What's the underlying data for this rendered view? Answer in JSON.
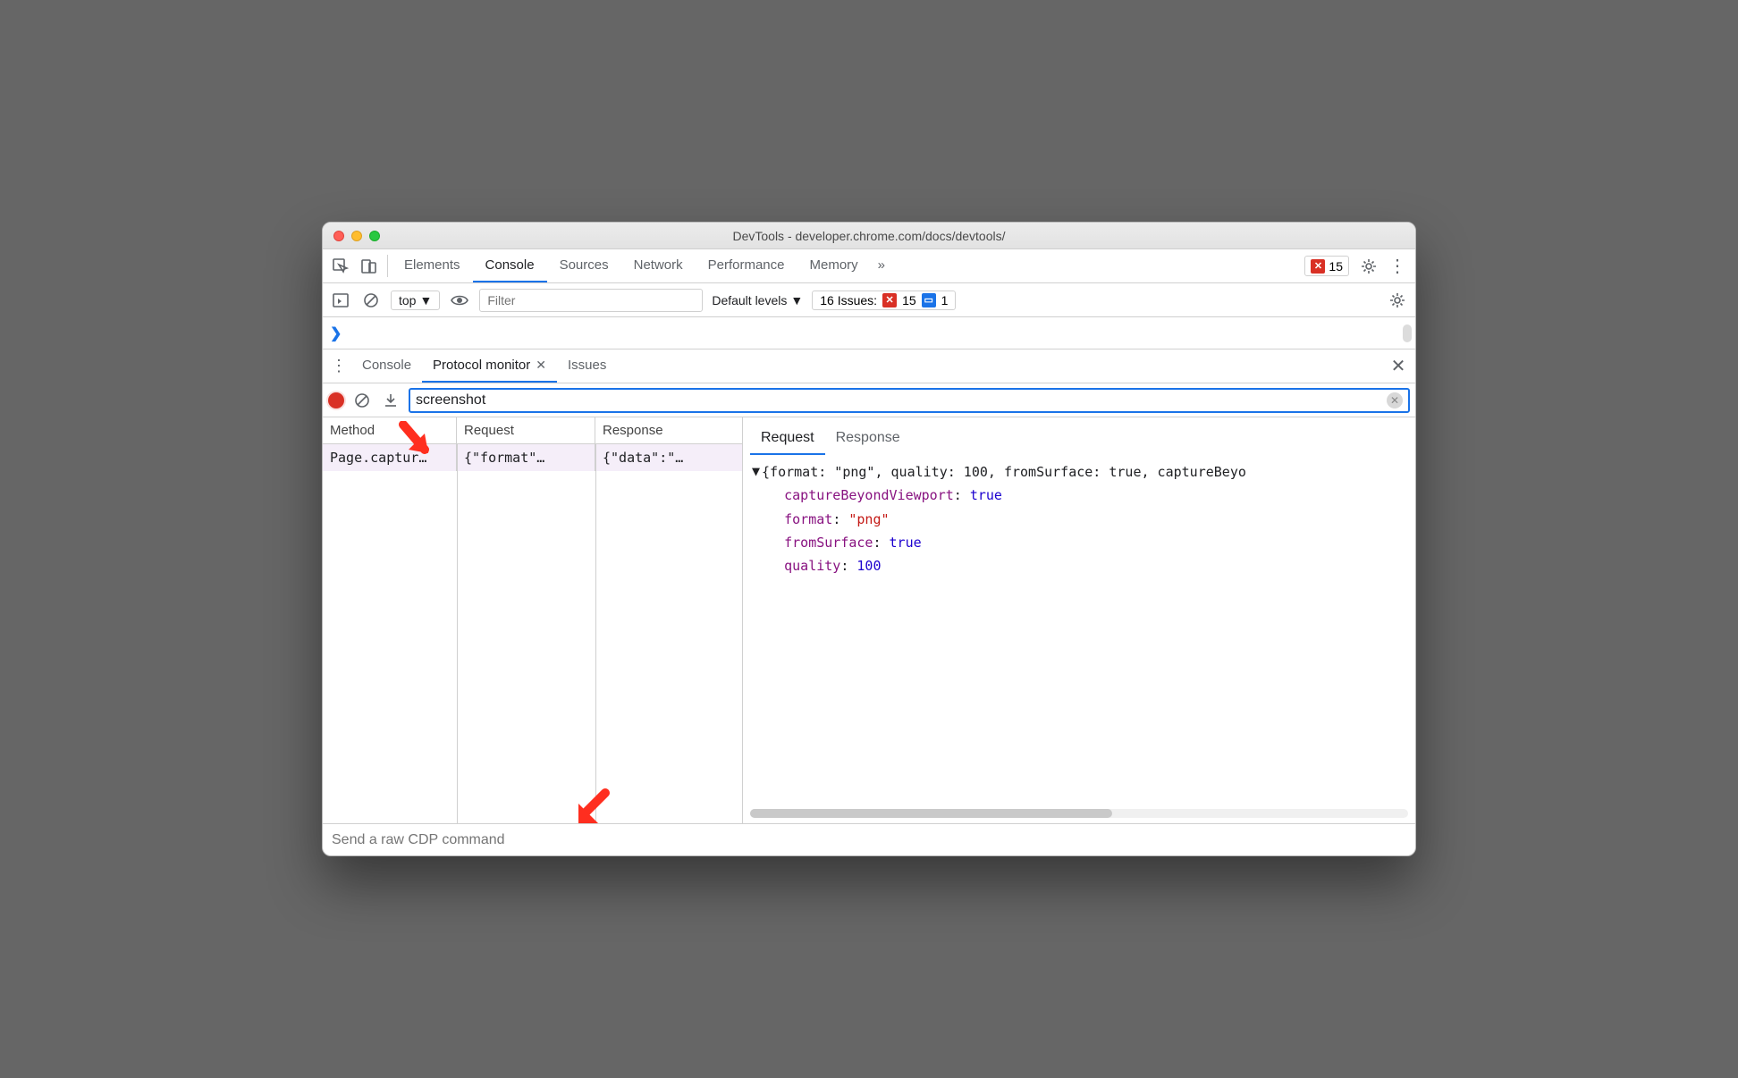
{
  "window": {
    "title": "DevTools - developer.chrome.com/docs/devtools/"
  },
  "top_tabs": {
    "items": [
      "Elements",
      "Console",
      "Sources",
      "Network",
      "Performance",
      "Memory"
    ],
    "active_index": 1,
    "overflow_glyph": "»",
    "error_count": "15"
  },
  "console_bar": {
    "context": "top",
    "filter_placeholder": "Filter",
    "levels": "Default levels",
    "issues_label": "16 Issues:",
    "issues_err": "15",
    "issues_info": "1"
  },
  "prompt_glyph": "❯",
  "drawer": {
    "tabs": [
      {
        "label": "Console",
        "closable": false
      },
      {
        "label": "Protocol monitor",
        "closable": true
      },
      {
        "label": "Issues",
        "closable": false
      }
    ],
    "active_index": 1
  },
  "pm": {
    "filter_value": "screenshot",
    "columns": [
      "Method",
      "Request",
      "Response"
    ],
    "rows": [
      {
        "method": "Page.captur…",
        "request": "{\"format\"…",
        "response": "{\"data\":\"…"
      }
    ],
    "detail_tabs": [
      "Request",
      "Response"
    ],
    "detail_active": 0,
    "detail_header": "{format: \"png\", quality: 100, fromSurface: true, captureBeyo",
    "detail_props": [
      {
        "key": "captureBeyondViewport",
        "val": "true",
        "type": "bool"
      },
      {
        "key": "format",
        "val": "\"png\"",
        "type": "str"
      },
      {
        "key": "fromSurface",
        "val": "true",
        "type": "bool"
      },
      {
        "key": "quality",
        "val": "100",
        "type": "num"
      }
    ]
  },
  "cmd_placeholder": "Send a raw CDP command"
}
